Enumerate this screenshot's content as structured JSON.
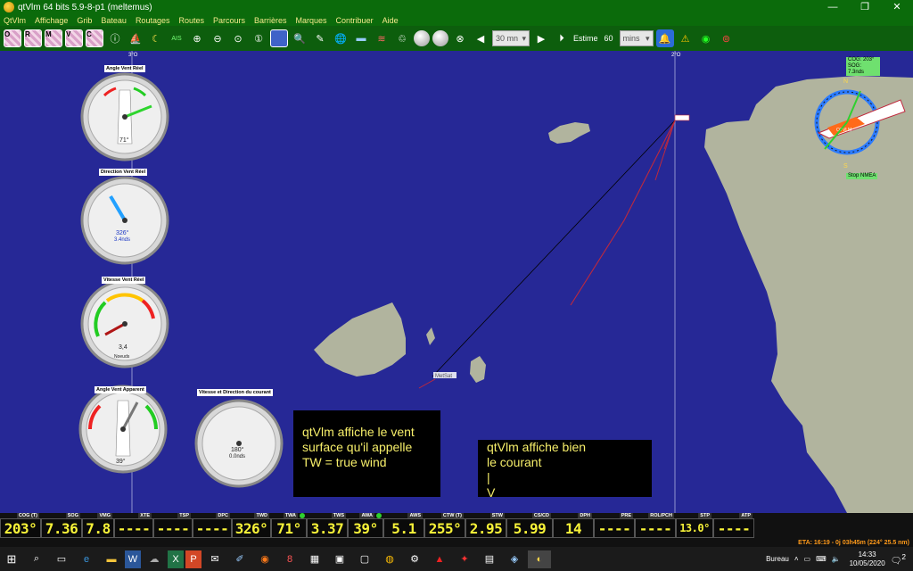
{
  "window": {
    "title": "qtVlm 64 bits 5.9-8-p1 (meltemus)",
    "controls": [
      "—",
      "❐",
      "✕"
    ]
  },
  "menu": [
    "QtVlm",
    "Affichage",
    "Grib",
    "Bateau",
    "Routages",
    "Routes",
    "Parcours",
    "Barrières",
    "Marques",
    "Contribuer",
    "Aide"
  ],
  "toolbar": {
    "pic_letters": [
      "O",
      "R",
      "M",
      "V",
      "C"
    ],
    "time_step": "30 mn",
    "estime_label": "Estime",
    "estime_value": "60",
    "estime_unit": "mins"
  },
  "map": {
    "meridian_labels": [
      "3°O",
      "2°O"
    ],
    "boat_label": "MetSat",
    "compass": {
      "cog_sog": "COG: 203° SOG: 7.3nds",
      "boat_name": "QTVLM",
      "stop_nmea": "Stop NMEA",
      "cardinals": [
        "N",
        "S"
      ]
    }
  },
  "gauges": [
    {
      "title": "Angle Vent Réel",
      "value": "71°",
      "sub": ""
    },
    {
      "title": "Direction Vent Réel",
      "value": "326°",
      "sub": "3.4nds"
    },
    {
      "title": "Vitesse Vent Réel",
      "value": "3,4",
      "sub": "Noeuds"
    },
    {
      "title": "Angle Vent Apparent",
      "value": "39°",
      "sub": ""
    },
    {
      "title": "Vitesse et Direction du courant",
      "value": "180°",
      "sub": "0.0nds"
    }
  ],
  "annotations": {
    "tw_note": [
      "qtVlm affiche le vent",
      "surface qu'il appelle",
      "TW = true wind"
    ],
    "current_note": [
      "qtVlm affiche bien",
      "le courant",
      "  |",
      "  V"
    ]
  },
  "instruments": [
    {
      "label": "COG (T)",
      "value": "203°"
    },
    {
      "label": "SOG",
      "value": "7.36"
    },
    {
      "label": "VMG",
      "value": "7.8"
    },
    {
      "label": "XTE",
      "value": "----"
    },
    {
      "label": "TSP",
      "value": "----"
    },
    {
      "label": "DPC",
      "value": "----"
    },
    {
      "label": "TWD",
      "value": "326°"
    },
    {
      "label": "TWA",
      "value": "71°"
    },
    {
      "label": "TWS",
      "value": "3.37"
    },
    {
      "label": "AWA",
      "value": "39°"
    },
    {
      "label": "AWS",
      "value": "5.1"
    },
    {
      "label": "CTW (T)",
      "value": "255°"
    },
    {
      "label": "STW",
      "value": "2.95"
    },
    {
      "label": "CS/CD",
      "value": "5.99"
    },
    {
      "label": "DPH",
      "value": "14"
    },
    {
      "label": "PRE",
      "value": "----"
    },
    {
      "label": "ROL/PCH",
      "value": "----"
    },
    {
      "label": "STP",
      "value": "13.0°"
    },
    {
      "label": "ATP",
      "value": "----"
    }
  ],
  "eta": "ETA: 16:19 - 0j 03h45m (224° 25.5 nm)",
  "taskbar": {
    "bureau": "Bureau",
    "time": "14:33",
    "date": "10/05/2020",
    "notif_count": "2"
  },
  "colors": {
    "sea": "#262896",
    "land": "#b1b49e",
    "app_green": "#0b6b0b",
    "menu_text": "#f5e98c",
    "instrument_text": "#f7f238",
    "annotation_text": "#f6ee6a",
    "track": "#c0283c",
    "eta_text": "#ff9a1a"
  }
}
